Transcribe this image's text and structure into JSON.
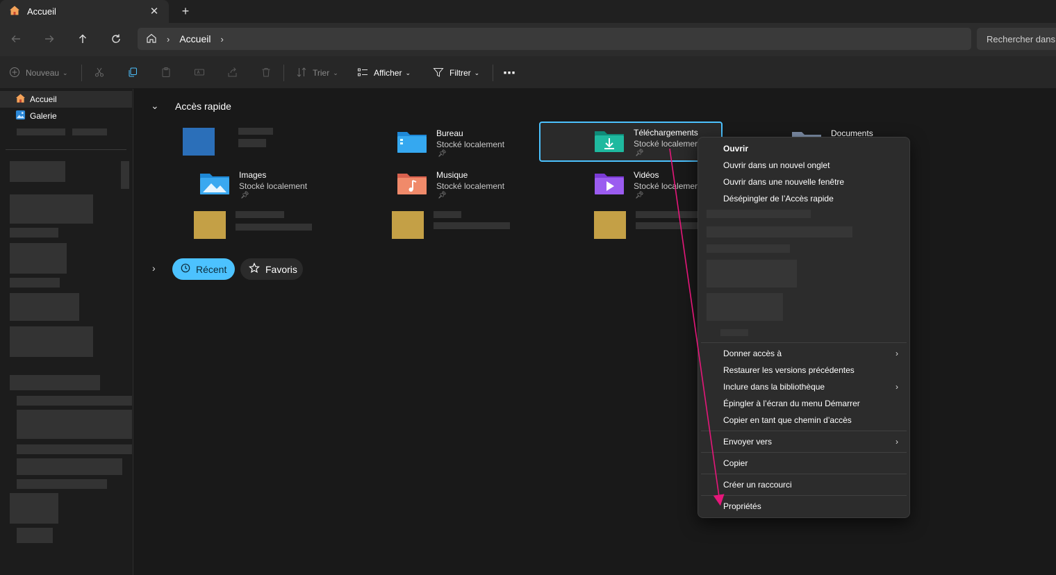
{
  "window": {
    "tab_title": "Accueil",
    "tab_close": "✕",
    "new_tab": "+"
  },
  "address": {
    "crumb_separator": "›",
    "crumb": "Accueil",
    "crumb_trailing": "›",
    "search_placeholder": "Rechercher dans"
  },
  "toolbar": {
    "new_label": "Nouveau",
    "sort_label": "Trier",
    "view_label": "Afficher",
    "filter_label": "Filtrer",
    "more_label": "⋯"
  },
  "sidebar": {
    "items": [
      {
        "label": "Accueil",
        "icon": "home-icon",
        "active": true
      },
      {
        "label": "Galerie",
        "icon": "gallery-icon",
        "active": false
      }
    ]
  },
  "main": {
    "section_title": "Accès rapide",
    "quick_access": [
      {
        "name": "Bureau",
        "subtitle": "Stocké localement",
        "icon": "desktop-folder-icon",
        "pinned": true
      },
      {
        "name": "Téléchargements",
        "subtitle": "Stocké localemer",
        "icon": "downloads-folder-icon",
        "pinned": true,
        "selected": true
      },
      {
        "name": "Documents",
        "subtitle": "",
        "icon": "documents-folder-icon",
        "pinned": true
      },
      {
        "name": "Images",
        "subtitle": "Stocké localement",
        "icon": "pictures-folder-icon",
        "pinned": true
      },
      {
        "name": "Musique",
        "subtitle": "Stocké localement",
        "icon": "music-folder-icon",
        "pinned": true
      },
      {
        "name": "Vidéos",
        "subtitle": "Stocké localemer",
        "icon": "videos-folder-icon",
        "pinned": true
      }
    ],
    "recent_label": "Récent",
    "favorites_label": "Favoris"
  },
  "context_menu": {
    "top_items": [
      "Ouvrir",
      "Ouvrir dans un nouvel onglet",
      "Ouvrir dans une nouvelle fenêtre",
      "Désépingler de l’Accès rapide"
    ],
    "mid_items": [
      {
        "label": "Donner accès à",
        "submenu": true
      },
      {
        "label": "Restaurer les versions précédentes",
        "submenu": false
      },
      {
        "label": "Inclure dans la bibliothèque",
        "submenu": true
      },
      {
        "label": "Épingler à l’écran du menu Démarrer",
        "submenu": false
      },
      {
        "label": "Copier en tant que chemin d’accès",
        "submenu": false
      }
    ],
    "send_to": "Envoyer vers",
    "copy": "Copier",
    "create_shortcut": "Créer un raccourci",
    "properties": "Propriétés",
    "submenu_arrow": "›"
  },
  "colors": {
    "accent": "#4cc2ff",
    "annotation_arrow": "#e5177a",
    "background": "#191919"
  }
}
